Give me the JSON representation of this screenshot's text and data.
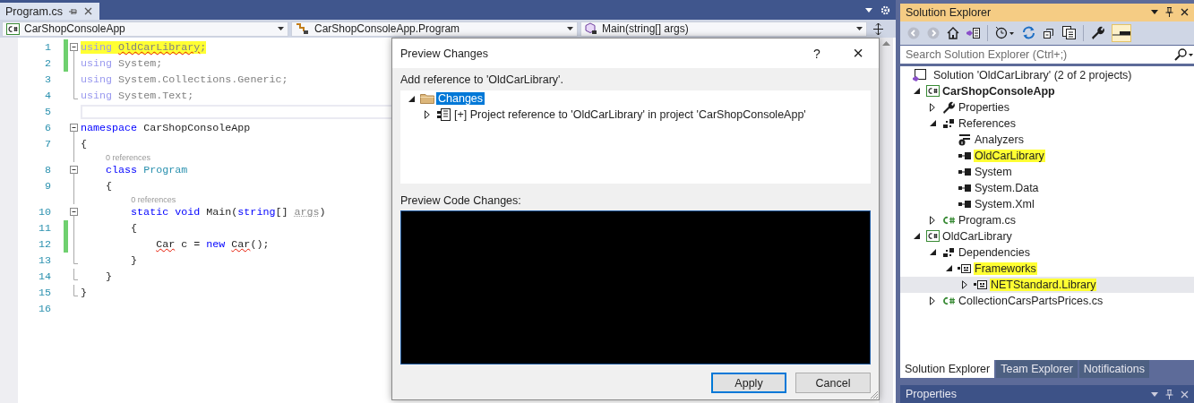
{
  "editor": {
    "tab": {
      "title": "Program.cs",
      "selected": true
    },
    "nav": [
      {
        "text": "CarShopConsoleApp",
        "kind": "project"
      },
      {
        "text": "CarShopConsoleApp.Program",
        "kind": "class"
      },
      {
        "text": "Main(string[] args)",
        "kind": "method"
      }
    ],
    "lines": [
      {
        "kind": "code",
        "number": "1",
        "changed": true,
        "current": false,
        "highlighted": true,
        "collapsible": true,
        "tokens": [
          {
            "text": "using ",
            "kind": "unused-keyword"
          },
          {
            "text": "OldCarLibrary",
            "kind": "unused-error"
          },
          {
            "text": ";",
            "kind": "unused"
          }
        ]
      },
      {
        "kind": "code",
        "number": "2",
        "changed": true,
        "current": false,
        "highlighted": false,
        "collapsible": false,
        "tokens": [
          {
            "text": "using ",
            "kind": "unused-keyword"
          },
          {
            "text": "System;",
            "kind": "unused"
          }
        ]
      },
      {
        "kind": "code",
        "number": "3",
        "changed": false,
        "current": false,
        "highlighted": false,
        "collapsible": false,
        "tokens": [
          {
            "text": "using ",
            "kind": "unused-keyword"
          },
          {
            "text": "System.Collections.Generic;",
            "kind": "unused"
          }
        ]
      },
      {
        "kind": "code",
        "number": "4",
        "changed": false,
        "current": false,
        "highlighted": false,
        "collapsible": false,
        "tokens": [
          {
            "text": "using ",
            "kind": "unused-keyword"
          },
          {
            "text": "System.Text;",
            "kind": "unused"
          }
        ]
      },
      {
        "kind": "code",
        "number": "5",
        "changed": false,
        "current": true,
        "highlighted": false,
        "collapsible": false
      },
      {
        "kind": "code",
        "number": "6",
        "changed": false,
        "current": false,
        "highlighted": false,
        "collapsible": true,
        "tokens": [
          {
            "text": "namespace ",
            "kind": "keyword"
          },
          {
            "text": "CarShopConsoleApp",
            "kind": "plain"
          }
        ]
      },
      {
        "kind": "code",
        "number": "7",
        "changed": false,
        "current": false,
        "highlighted": false,
        "collapsible": false,
        "tokens": [
          {
            "text": "{",
            "kind": "plain"
          }
        ]
      },
      {
        "kind": "codelens",
        "text": "0 references"
      },
      {
        "kind": "code",
        "number": "8",
        "changed": false,
        "current": false,
        "highlighted": false,
        "collapsible": true,
        "tokens": [
          {
            "text": "class ",
            "kind": "keyword"
          },
          {
            "text": "Program",
            "kind": "type"
          }
        ]
      },
      {
        "kind": "code",
        "number": "9",
        "changed": false,
        "current": false,
        "highlighted": false,
        "collapsible": false,
        "tokens": [
          {
            "text": "{",
            "kind": "plain"
          }
        ]
      },
      {
        "kind": "codelens",
        "text": "0 references"
      },
      {
        "kind": "code",
        "number": "10",
        "changed": false,
        "current": false,
        "highlighted": false,
        "collapsible": true,
        "tokens": [
          {
            "text": "static void ",
            "kind": "keyword"
          },
          {
            "text": "Main(",
            "kind": "plain"
          },
          {
            "text": "string",
            "kind": "keyword"
          },
          {
            "text": "[] ",
            "kind": "plain"
          },
          {
            "text": "args",
            "kind": "faded"
          },
          {
            "text": ")",
            "kind": "plain"
          }
        ]
      },
      {
        "kind": "code",
        "number": "11",
        "changed": true,
        "current": false,
        "highlighted": false,
        "collapsible": false,
        "tokens": [
          {
            "text": "{",
            "kind": "plain"
          }
        ]
      },
      {
        "kind": "code",
        "number": "12",
        "changed": true,
        "current": false,
        "highlighted": false,
        "collapsible": false,
        "tokens": [
          {
            "text": "Car",
            "kind": "error"
          },
          {
            "text": " c = ",
            "kind": "plain"
          },
          {
            "text": "new ",
            "kind": "keyword"
          },
          {
            "text": "Car",
            "kind": "error"
          },
          {
            "text": "();",
            "kind": "plain"
          }
        ]
      },
      {
        "kind": "code",
        "number": "13",
        "changed": false,
        "current": false,
        "highlighted": false,
        "collapsible": false,
        "tokens": [
          {
            "text": "}",
            "kind": "plain"
          }
        ]
      },
      {
        "kind": "code",
        "number": "14",
        "changed": false,
        "current": false,
        "highlighted": false,
        "collapsible": false,
        "tokens": [
          {
            "text": "}",
            "kind": "plain"
          }
        ]
      },
      {
        "kind": "code",
        "number": "15",
        "changed": false,
        "current": false,
        "highlighted": false,
        "collapsible": false,
        "tokens": [
          {
            "text": "}",
            "kind": "plain"
          }
        ]
      },
      {
        "kind": "code",
        "number": "16",
        "changed": false,
        "current": false,
        "highlighted": false,
        "collapsible": false
      }
    ]
  },
  "dialog": {
    "title": "Preview Changes",
    "help": "?",
    "close": "×",
    "message": "Add reference to 'OldCarLibrary'.",
    "changes": [
      {
        "label": "Changes",
        "kind": "folder",
        "expanded": true,
        "selected": true,
        "children": [
          {
            "label": "[+] Project reference to 'OldCarLibrary' in project 'CarShopConsoleApp'",
            "kind": "reference",
            "expanded": false,
            "selected": false
          }
        ]
      }
    ],
    "preview_label": "Preview Code Changes:",
    "buttons": [
      {
        "label": "Apply",
        "default": true
      },
      {
        "label": "Cancel",
        "default": false
      }
    ]
  },
  "solution_explorer": {
    "title": "Solution Explorer",
    "search": {
      "placeholder": "Search Solution Explorer (Ctrl+;)"
    },
    "solution": {
      "label": "Solution 'OldCarLibrary' (2 of 2 projects)"
    },
    "projects": [
      {
        "label": "CarShopConsoleApp",
        "kind": "csproj",
        "startup": true,
        "expanded": true,
        "highlighted": false,
        "selected": false,
        "children": [
          {
            "label": "Properties",
            "kind": "wrench",
            "expanded": false,
            "highlighted": false,
            "selected": false
          },
          {
            "label": "References",
            "kind": "references",
            "expanded": true,
            "highlighted": false,
            "selected": false,
            "children": [
              {
                "label": "Analyzers",
                "kind": "analyzers",
                "highlighted": false,
                "selected": false
              },
              {
                "label": "OldCarLibrary",
                "kind": "assembly",
                "highlighted": true,
                "selected": false
              },
              {
                "label": "System",
                "kind": "assembly",
                "highlighted": false,
                "selected": false
              },
              {
                "label": "System.Data",
                "kind": "assembly",
                "highlighted": false,
                "selected": false
              },
              {
                "label": "System.Xml",
                "kind": "assembly",
                "highlighted": false,
                "selected": false
              }
            ]
          },
          {
            "label": "Program.cs",
            "kind": "csfile",
            "expanded": false,
            "highlighted": false,
            "selected": false
          }
        ]
      },
      {
        "label": "OldCarLibrary",
        "kind": "csproj",
        "startup": false,
        "expanded": true,
        "highlighted": false,
        "selected": false,
        "children": [
          {
            "label": "Dependencies",
            "kind": "dependencies",
            "expanded": true,
            "highlighted": false,
            "selected": false,
            "children": [
              {
                "label": "Frameworks",
                "kind": "frameworks",
                "expanded": true,
                "highlighted": true,
                "selected": false,
                "children": [
                  {
                    "label": "NETStandard.Library",
                    "kind": "package",
                    "expanded": false,
                    "highlighted": true,
                    "selected": true
                  }
                ]
              }
            ]
          },
          {
            "label": "CollectionCarsPartsPrices.cs",
            "kind": "csfile",
            "expanded": false,
            "highlighted": false,
            "selected": false
          }
        ]
      }
    ],
    "tabs": [
      {
        "label": "Solution Explorer",
        "selected": true
      },
      {
        "label": "Team Explorer",
        "selected": false
      },
      {
        "label": "Notifications",
        "selected": false
      }
    ]
  },
  "properties": {
    "title": "Properties"
  }
}
